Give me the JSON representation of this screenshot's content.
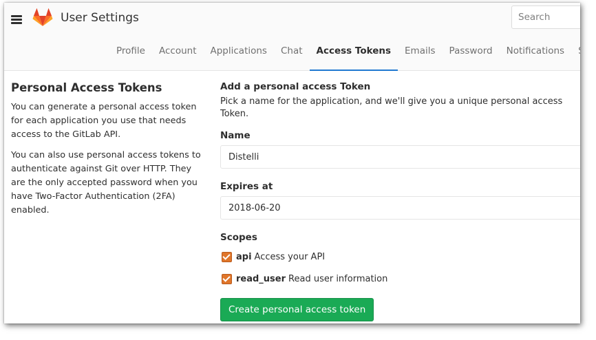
{
  "header": {
    "title": "User Settings",
    "search_placeholder": "Search"
  },
  "tabs": [
    {
      "label": "Profile",
      "active": false
    },
    {
      "label": "Account",
      "active": false
    },
    {
      "label": "Applications",
      "active": false
    },
    {
      "label": "Chat",
      "active": false
    },
    {
      "label": "Access Tokens",
      "active": true
    },
    {
      "label": "Emails",
      "active": false
    },
    {
      "label": "Password",
      "active": false
    },
    {
      "label": "Notifications",
      "active": false
    },
    {
      "label": "SSH Keys",
      "active": false
    }
  ],
  "left": {
    "heading": "Personal Access Tokens",
    "paragraph1": "You can generate a personal access token for each application you use that needs access to the GitLab API.",
    "paragraph2": "You can also use personal access tokens to authenticate against Git over HTTP. They are the only accepted password when you have Two-Factor Authentication (2FA) enabled."
  },
  "form": {
    "title": "Add a personal access Token",
    "description": "Pick a name for the application, and we'll give you a unique personal access Token.",
    "name_label": "Name",
    "name_value": "Distelli",
    "expires_label": "Expires at",
    "expires_value": "2018-06-20",
    "scopes_label": "Scopes",
    "scopes": [
      {
        "name": "api",
        "description": "Access your API",
        "checked": true
      },
      {
        "name": "read_user",
        "description": "Read user information",
        "checked": true
      }
    ],
    "submit_label": "Create personal access token"
  },
  "colors": {
    "accent_blue": "#1f78d1",
    "button_green": "#1aaa55",
    "checkbox_orange": "#e0762a",
    "logo_orange": "#fc6d26"
  }
}
